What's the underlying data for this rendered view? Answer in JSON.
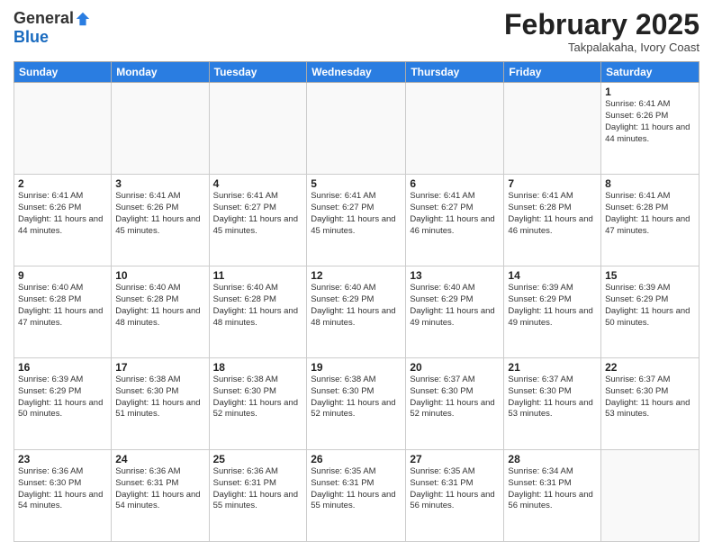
{
  "logo": {
    "general": "General",
    "blue": "Blue"
  },
  "header": {
    "month": "February 2025",
    "location": "Takpalakaha, Ivory Coast"
  },
  "weekdays": [
    "Sunday",
    "Monday",
    "Tuesday",
    "Wednesday",
    "Thursday",
    "Friday",
    "Saturday"
  ],
  "weeks": [
    [
      {
        "day": "",
        "info": ""
      },
      {
        "day": "",
        "info": ""
      },
      {
        "day": "",
        "info": ""
      },
      {
        "day": "",
        "info": ""
      },
      {
        "day": "",
        "info": ""
      },
      {
        "day": "",
        "info": ""
      },
      {
        "day": "1",
        "info": "Sunrise: 6:41 AM\nSunset: 6:26 PM\nDaylight: 11 hours\nand 44 minutes."
      }
    ],
    [
      {
        "day": "2",
        "info": "Sunrise: 6:41 AM\nSunset: 6:26 PM\nDaylight: 11 hours\nand 44 minutes."
      },
      {
        "day": "3",
        "info": "Sunrise: 6:41 AM\nSunset: 6:26 PM\nDaylight: 11 hours\nand 45 minutes."
      },
      {
        "day": "4",
        "info": "Sunrise: 6:41 AM\nSunset: 6:27 PM\nDaylight: 11 hours\nand 45 minutes."
      },
      {
        "day": "5",
        "info": "Sunrise: 6:41 AM\nSunset: 6:27 PM\nDaylight: 11 hours\nand 45 minutes."
      },
      {
        "day": "6",
        "info": "Sunrise: 6:41 AM\nSunset: 6:27 PM\nDaylight: 11 hours\nand 46 minutes."
      },
      {
        "day": "7",
        "info": "Sunrise: 6:41 AM\nSunset: 6:28 PM\nDaylight: 11 hours\nand 46 minutes."
      },
      {
        "day": "8",
        "info": "Sunrise: 6:41 AM\nSunset: 6:28 PM\nDaylight: 11 hours\nand 47 minutes."
      }
    ],
    [
      {
        "day": "9",
        "info": "Sunrise: 6:40 AM\nSunset: 6:28 PM\nDaylight: 11 hours\nand 47 minutes."
      },
      {
        "day": "10",
        "info": "Sunrise: 6:40 AM\nSunset: 6:28 PM\nDaylight: 11 hours\nand 48 minutes."
      },
      {
        "day": "11",
        "info": "Sunrise: 6:40 AM\nSunset: 6:28 PM\nDaylight: 11 hours\nand 48 minutes."
      },
      {
        "day": "12",
        "info": "Sunrise: 6:40 AM\nSunset: 6:29 PM\nDaylight: 11 hours\nand 48 minutes."
      },
      {
        "day": "13",
        "info": "Sunrise: 6:40 AM\nSunset: 6:29 PM\nDaylight: 11 hours\nand 49 minutes."
      },
      {
        "day": "14",
        "info": "Sunrise: 6:39 AM\nSunset: 6:29 PM\nDaylight: 11 hours\nand 49 minutes."
      },
      {
        "day": "15",
        "info": "Sunrise: 6:39 AM\nSunset: 6:29 PM\nDaylight: 11 hours\nand 50 minutes."
      }
    ],
    [
      {
        "day": "16",
        "info": "Sunrise: 6:39 AM\nSunset: 6:29 PM\nDaylight: 11 hours\nand 50 minutes."
      },
      {
        "day": "17",
        "info": "Sunrise: 6:38 AM\nSunset: 6:30 PM\nDaylight: 11 hours\nand 51 minutes."
      },
      {
        "day": "18",
        "info": "Sunrise: 6:38 AM\nSunset: 6:30 PM\nDaylight: 11 hours\nand 52 minutes."
      },
      {
        "day": "19",
        "info": "Sunrise: 6:38 AM\nSunset: 6:30 PM\nDaylight: 11 hours\nand 52 minutes."
      },
      {
        "day": "20",
        "info": "Sunrise: 6:37 AM\nSunset: 6:30 PM\nDaylight: 11 hours\nand 52 minutes."
      },
      {
        "day": "21",
        "info": "Sunrise: 6:37 AM\nSunset: 6:30 PM\nDaylight: 11 hours\nand 53 minutes."
      },
      {
        "day": "22",
        "info": "Sunrise: 6:37 AM\nSunset: 6:30 PM\nDaylight: 11 hours\nand 53 minutes."
      }
    ],
    [
      {
        "day": "23",
        "info": "Sunrise: 6:36 AM\nSunset: 6:30 PM\nDaylight: 11 hours\nand 54 minutes."
      },
      {
        "day": "24",
        "info": "Sunrise: 6:36 AM\nSunset: 6:31 PM\nDaylight: 11 hours\nand 54 minutes."
      },
      {
        "day": "25",
        "info": "Sunrise: 6:36 AM\nSunset: 6:31 PM\nDaylight: 11 hours\nand 55 minutes."
      },
      {
        "day": "26",
        "info": "Sunrise: 6:35 AM\nSunset: 6:31 PM\nDaylight: 11 hours\nand 55 minutes."
      },
      {
        "day": "27",
        "info": "Sunrise: 6:35 AM\nSunset: 6:31 PM\nDaylight: 11 hours\nand 56 minutes."
      },
      {
        "day": "28",
        "info": "Sunrise: 6:34 AM\nSunset: 6:31 PM\nDaylight: 11 hours\nand 56 minutes."
      },
      {
        "day": "",
        "info": ""
      }
    ]
  ]
}
